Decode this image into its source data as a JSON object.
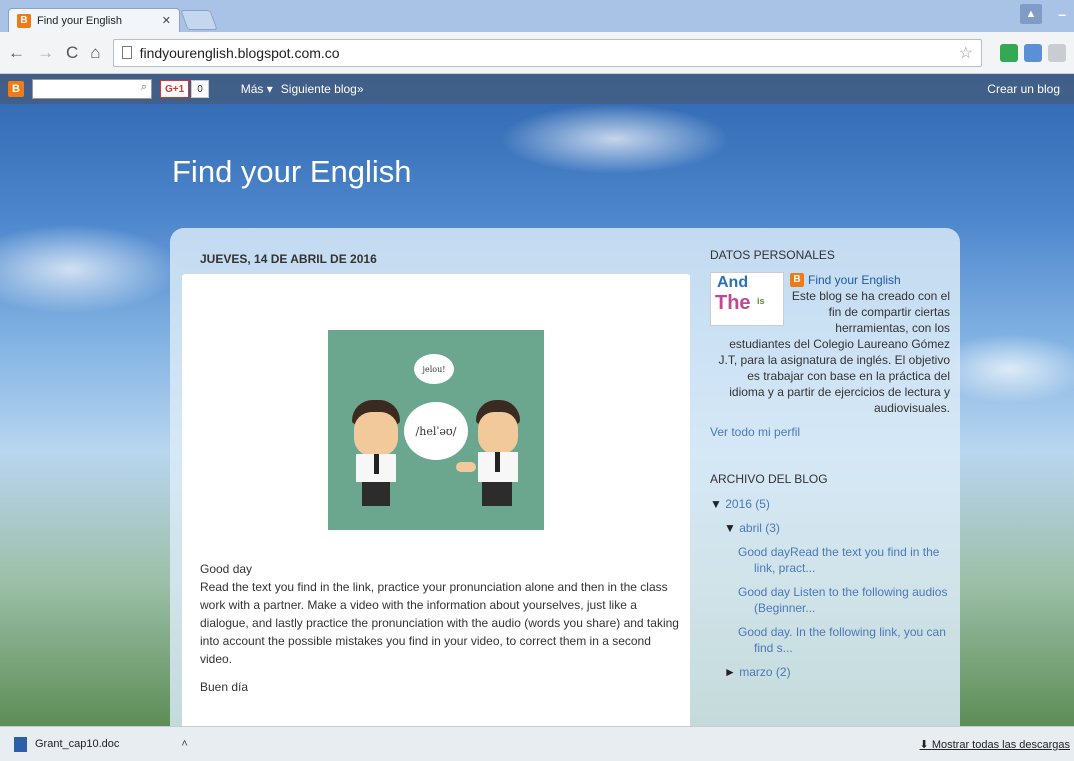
{
  "browser": {
    "tab_title": "Find your English",
    "tab_favicon": "B",
    "url": "findyourenglish.blogspot.com.co",
    "profile_glyph": "▲"
  },
  "blogger_navbar": {
    "logo": "B",
    "gplus": "G+1",
    "gplus_count": "0",
    "more": "Más ▾",
    "next_blog": "Siguiente blog»",
    "create": "Crear un blog"
  },
  "blog": {
    "title": "Find your English"
  },
  "post": {
    "date": "JUEVES, 14 DE ABRIL DE 2016",
    "bubble_small": "jelou!",
    "bubble_large": "/helˈəʊ/",
    "heading": "Good day",
    "body": "Read the text you find in the link, practice your pronunciation alone and then in the class work with a partner. Make a video with the information about yourselves, just like a dialogue, and lastly practice the pronunciation with  the audio (words you share) and taking into account the possible mistakes you find in your video, to correct them in a second video.",
    "second": "Buen día"
  },
  "sidebar": {
    "profile_heading": "DATOS PERSONALES",
    "profile_name": "Find your English",
    "profile_text": "Este blog se ha creado con el fin de compartir ciertas herramientas, con los estudiantes del Colegio Laureano Gómez J.T, para la asignatura de inglés. El objetivo es trabajar con base en la práctica del idioma y a partir de ejercicios de lectura y audiovisuales.",
    "profile_link": "Ver todo mi perfil",
    "archive_heading": "ARCHIVO DEL BLOG",
    "year": "2016 (5)",
    "month": "abril (3)",
    "posts": [
      "Good dayRead the text you find in the link, pract...",
      "Good day Listen to the following audios (Beginner...",
      "Good day. In the following link, you can find s..."
    ],
    "month2": "marzo (2)"
  },
  "downloads": {
    "file": "Grant_cap10.doc",
    "show_all": "Mostrar todas las descargas"
  }
}
